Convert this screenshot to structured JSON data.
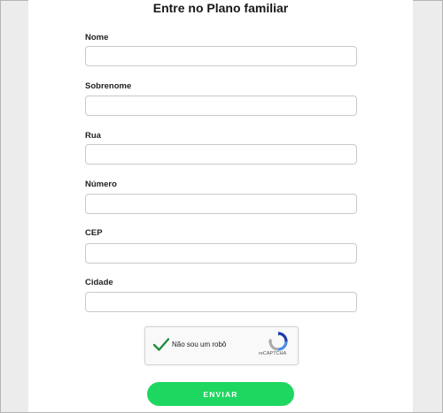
{
  "form": {
    "title": "Entre no Plano familiar",
    "fields": [
      {
        "label": "Nome",
        "value": ""
      },
      {
        "label": "Sobrenome",
        "value": ""
      },
      {
        "label": "Rua",
        "value": ""
      },
      {
        "label": "Número",
        "value": ""
      },
      {
        "label": "CEP",
        "value": ""
      },
      {
        "label": "Cidade",
        "value": ""
      }
    ],
    "captcha": {
      "label": "Não sou um robô",
      "brand": "reCAPTCHA",
      "checked": true,
      "check_color": "#1e8e3e"
    },
    "submit_label": "ENVIAR",
    "accent_color": "#1ed760"
  }
}
